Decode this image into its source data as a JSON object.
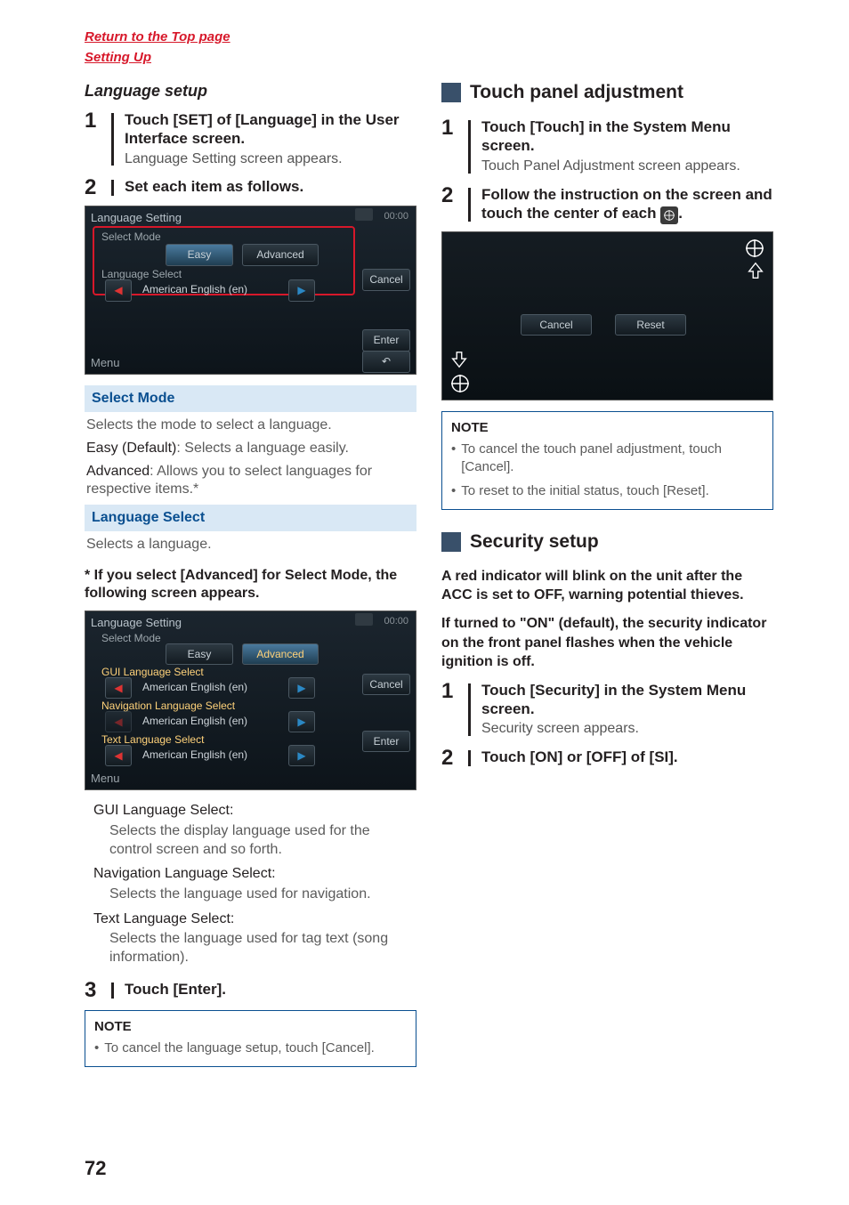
{
  "top_links": {
    "return": "Return to the Top page",
    "setting_up": "Setting Up"
  },
  "left": {
    "heading": "Language setup",
    "step1": {
      "num": "1",
      "title": "Touch [SET] of [Language] in the User Interface screen.",
      "sub": "Language Setting screen appears."
    },
    "step2": {
      "num": "2",
      "title": "Set each item as follows."
    },
    "ss1": {
      "title": "Language Setting",
      "clock": "00:00",
      "select_mode": "Select Mode",
      "easy": "Easy",
      "advanced": "Advanced",
      "lang_select": "Language Select",
      "lang_value": "American English (en)",
      "cancel": "Cancel",
      "enter": "Enter",
      "menu": "Menu"
    },
    "select_mode_header": "Select Mode",
    "select_mode_desc": "Selects the mode to select a language.",
    "easy_line_label": "Easy (Default)",
    "easy_line_rest": ": Selects a language easily.",
    "adv_line_label": "Advanced",
    "adv_line_rest": ": Allows you to select languages for respective items.*",
    "lang_select_header": "Language Select",
    "lang_select_desc": "Selects a language.",
    "asterisk_note": "* If you select [Advanced] for Select Mode, the following screen appears.",
    "ss2": {
      "title": "Language Setting",
      "clock": "00:00",
      "select_mode": "Select Mode",
      "easy": "Easy",
      "advanced": "Advanced",
      "gui": "GUI Language Select",
      "nav": "Navigation Language Select",
      "text": "Text Language Select",
      "lang_value": "American English (en)",
      "cancel": "Cancel",
      "enter": "Enter",
      "menu": "Menu"
    },
    "defs": {
      "gui_term": "GUI Language Select",
      "gui_desc": "Selects the display language used for the control screen and so forth.",
      "nav_term": "Navigation Language Select",
      "nav_desc": "Selects the language used for navigation.",
      "text_term": "Text Language Select",
      "text_desc": "Selects the language used for tag text (song information)."
    },
    "step3": {
      "num": "3",
      "title": "Touch [Enter]."
    },
    "note_title": "NOTE",
    "note_item": "To cancel the language setup, touch [Cancel]."
  },
  "right": {
    "touch_panel_header": "Touch panel adjustment",
    "step1": {
      "num": "1",
      "title": "Touch [Touch] in the System Menu screen.",
      "sub": "Touch Panel Adjustment screen appears."
    },
    "step2": {
      "num": "2",
      "title_a": "Follow the instruction on the screen and touch the center of each ",
      "title_b": "."
    },
    "tp": {
      "cancel": "Cancel",
      "reset": "Reset"
    },
    "note_title": "NOTE",
    "note_item1": "To cancel the touch panel adjustment, touch [Cancel].",
    "note_item2": "To reset to the initial status, touch [Reset].",
    "security_header": "Security setup",
    "security_p1": "A red indicator will blink on the unit after the ACC is set to OFF, warning potential thieves.",
    "security_p2": "If turned to \"ON\" (default), the security indicator on the front panel flashes when the vehicle ignition is off.",
    "sec_step1": {
      "num": "1",
      "title": "Touch [Security] in the System Menu screen.",
      "sub": "Security screen appears."
    },
    "sec_step2": {
      "num": "2",
      "title": "Touch [ON] or [OFF] of [SI]."
    }
  },
  "page_number": "72"
}
